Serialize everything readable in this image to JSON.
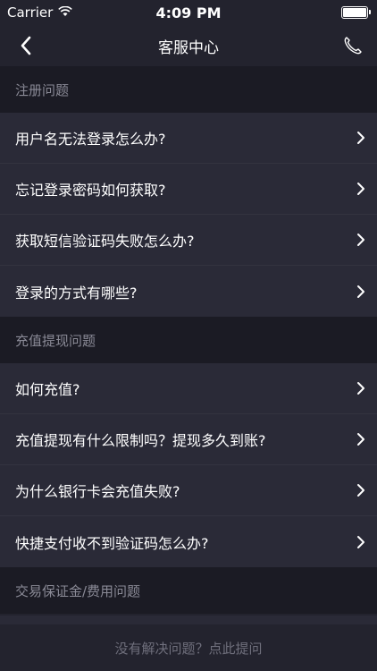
{
  "status_bar": {
    "carrier": "Carrier",
    "time": "4:09 PM",
    "icons": [
      "wifi-icon",
      "battery-icon"
    ]
  },
  "nav": {
    "title": "客服中心",
    "back_icon": "chevron-left-icon",
    "phone_icon": "phone-icon"
  },
  "sections": [
    {
      "title": "注册问题",
      "items": [
        {
          "label": "用户名无法登录怎么办?"
        },
        {
          "label": "忘记登录密码如何获取?"
        },
        {
          "label": "获取短信验证码失败怎么办?"
        },
        {
          "label": "登录的方式有哪些?"
        }
      ]
    },
    {
      "title": "充值提现问题",
      "items": [
        {
          "label": "如何充值?"
        },
        {
          "label": "充值提现有什么限制吗？提现多久到账?"
        },
        {
          "label": "为什么银行卡会充值失败?"
        },
        {
          "label": "快捷支付收不到验证码怎么办?"
        }
      ]
    },
    {
      "title": "交易保证金/费用问题",
      "items": []
    }
  ],
  "footer": {
    "text": "没有解决问题？点此提问"
  }
}
